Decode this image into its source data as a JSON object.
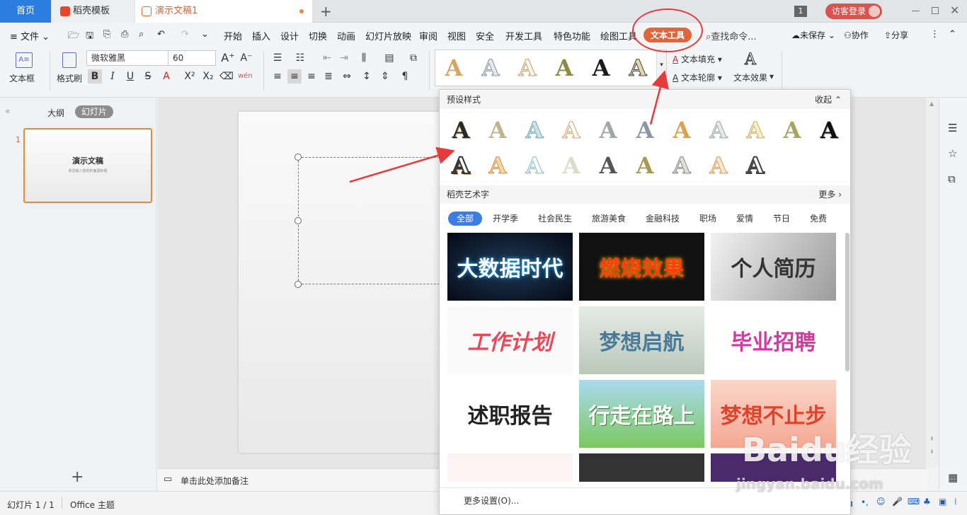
{
  "tabs": {
    "home": "首页",
    "templates": "稻壳模板",
    "doc": "演示文稿1"
  },
  "titlebar": {
    "page_badge": "1",
    "guest_login": "访客登录"
  },
  "menu": {
    "file": "文件",
    "items": [
      "开始",
      "插入",
      "设计",
      "切换",
      "动画",
      "幻灯片放映",
      "审阅",
      "视图",
      "安全",
      "开发工具",
      "特色功能",
      "绘图工具",
      "文本工具"
    ],
    "search": "查找命令...",
    "unsaved": "未保存",
    "collab": "协作",
    "share": "分享"
  },
  "ribbon": {
    "textbox": "文本框",
    "format_painter": "格式刷",
    "font_name": "微软雅黑",
    "font_size": "60",
    "text_fill": "文本填充",
    "text_outline": "文本轮廓",
    "text_effect": "文本效果",
    "art_letter": "A"
  },
  "dropdown": {
    "preset_title": "预设样式",
    "collapse": "收起",
    "wordart_title": "稻壳艺术字",
    "more": "更多",
    "categories": [
      "全部",
      "开学季",
      "社会民生",
      "旅游美食",
      "金融科技",
      "职场",
      "爱情",
      "节日",
      "免费"
    ],
    "cards": [
      "大数据时代",
      "燃烧效果",
      "个人简历",
      "工作计划",
      "梦想启航",
      "毕业招聘",
      "述职报告",
      "行走在路上",
      "梦想不止步"
    ],
    "more_settings": "更多设置(O)..."
  },
  "left_panel": {
    "outline": "大纲",
    "slides": "幻灯片",
    "slide_num": "1",
    "thumb_title": "演示文稿",
    "thumb_sub": "单击输入您的封面副标题"
  },
  "notes": {
    "placeholder": "单击此处添加备注"
  },
  "status": {
    "slide_counter": "幻灯片 1 / 1",
    "theme": "Office 主题",
    "ime": "中"
  },
  "watermark": {
    "brand": "Baidu经验",
    "url": "jingyan.baidu.com"
  },
  "colors": {
    "accent_blue": "#2b7ee0",
    "wps_orange": "#e0663a",
    "annotation_red": "#e83a3a"
  }
}
